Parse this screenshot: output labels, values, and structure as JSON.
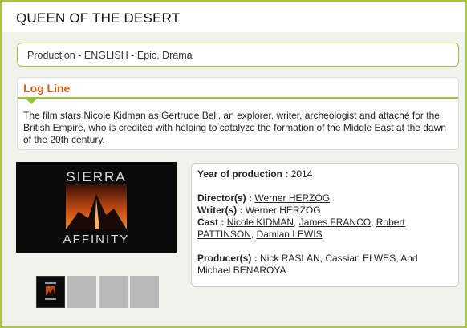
{
  "page": {
    "title": "QUEEN OF THE DESERT"
  },
  "production_line": "Production - ENGLISH - Epic, Drama",
  "logline": {
    "heading": "Log Line",
    "text": "The film stars Nicole Kidman as Gertrude Bell, an explorer, writer, archeologist and attaché for the British Empire, who is credited with helping to catalyze the formation of the Middle East at the dawn of the 20th century."
  },
  "poster": {
    "logo_text_top": "SIERRA",
    "logo_text_bottom": "AFFINITY"
  },
  "thumbnails": [
    {
      "active": true
    },
    {
      "active": false
    },
    {
      "active": false
    },
    {
      "active": false
    }
  ],
  "details": {
    "year_label": "Year of production :",
    "year_value": "2014",
    "directors_label": "Director(s) :",
    "director": "Werner HERZOG",
    "writers_label": "Writer(s) :",
    "writer": "Werner HERZOG",
    "cast_label": "Cast :",
    "cast": [
      "Nicole KIDMAN",
      "James FRANCO",
      "Robert PATTINSON",
      "Damian LEWIS"
    ],
    "producers_label": "Producer(s) :",
    "producers": "Nick RASLAN, Cassian ELWES, And Michael BENAROYA"
  },
  "colors": {
    "accent_green": "#9cc23a",
    "heading_orange": "#d2601a",
    "poster_background": "#0a0a0a",
    "logo_orange": "#e0601c"
  }
}
